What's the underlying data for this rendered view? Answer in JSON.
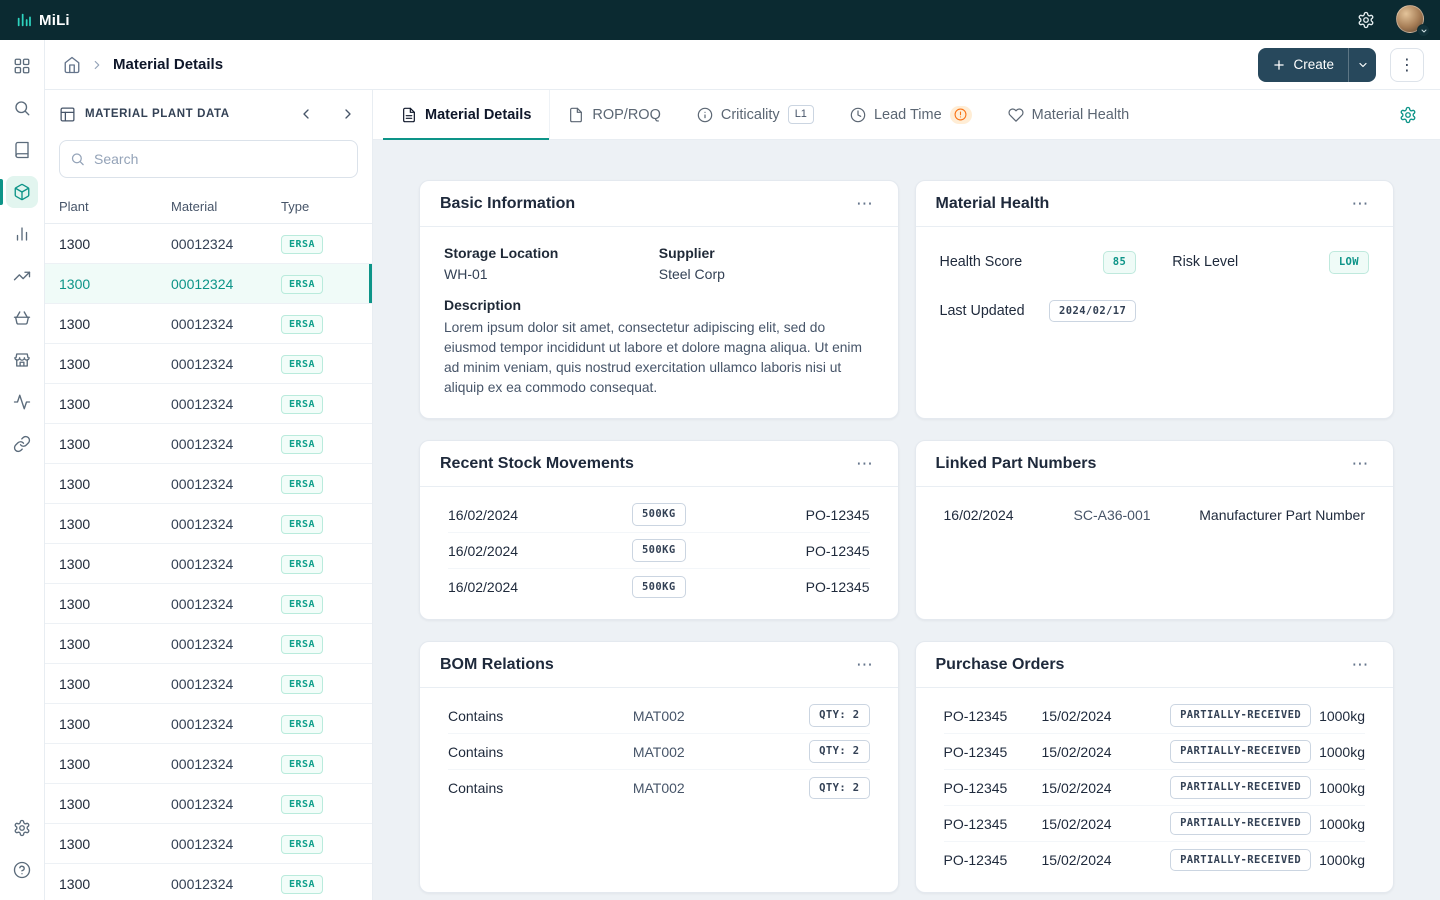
{
  "icons": {
    "kebab": "⋮",
    "ellipsis": "⋯"
  },
  "colors": {
    "accent_teal": "#0d9488",
    "topbar": "#0b2a31",
    "create_button": "#27485c",
    "warning_orange": "#f97316"
  },
  "topbar": {
    "logo": "MiLi"
  },
  "breadcrumb": {
    "page": "Material Details"
  },
  "actions": {
    "create": "Create"
  },
  "left_panel": {
    "title": "MATERIAL PLANT DATA",
    "search_placeholder": "Search",
    "columns": [
      "Plant",
      "Material",
      "Type"
    ],
    "rows": [
      {
        "plant": "1300",
        "material": "00012324",
        "type": "ERSA"
      },
      {
        "plant": "1300",
        "material": "00012324",
        "type": "ERSA",
        "selected": true
      },
      {
        "plant": "1300",
        "material": "00012324",
        "type": "ERSA"
      },
      {
        "plant": "1300",
        "material": "00012324",
        "type": "ERSA"
      },
      {
        "plant": "1300",
        "material": "00012324",
        "type": "ERSA"
      },
      {
        "plant": "1300",
        "material": "00012324",
        "type": "ERSA"
      },
      {
        "plant": "1300",
        "material": "00012324",
        "type": "ERSA"
      },
      {
        "plant": "1300",
        "material": "00012324",
        "type": "ERSA"
      },
      {
        "plant": "1300",
        "material": "00012324",
        "type": "ERSA"
      },
      {
        "plant": "1300",
        "material": "00012324",
        "type": "ERSA"
      },
      {
        "plant": "1300",
        "material": "00012324",
        "type": "ERSA"
      },
      {
        "plant": "1300",
        "material": "00012324",
        "type": "ERSA"
      },
      {
        "plant": "1300",
        "material": "00012324",
        "type": "ERSA"
      },
      {
        "plant": "1300",
        "material": "00012324",
        "type": "ERSA"
      },
      {
        "plant": "1300",
        "material": "00012324",
        "type": "ERSA"
      },
      {
        "plant": "1300",
        "material": "00012324",
        "type": "ERSA"
      },
      {
        "plant": "1300",
        "material": "00012324",
        "type": "ERSA"
      }
    ]
  },
  "tabs": [
    {
      "label": "Material Details"
    },
    {
      "label": "ROP/ROQ"
    },
    {
      "label": "Criticality",
      "badge": "L1"
    },
    {
      "label": "Lead Time"
    },
    {
      "label": "Material Health"
    }
  ],
  "cards": {
    "basic": {
      "title": "Basic Information",
      "fields": [
        {
          "label": "Storage Location",
          "value": "WH-01"
        },
        {
          "label": "Supplier",
          "value": "Steel Corp"
        }
      ],
      "description_label": "Description",
      "description": "Lorem ipsum dolor sit amet, consectetur adipiscing elit, sed do eiusmod tempor incididunt ut labore et dolore magna aliqua. Ut enim ad minim veniam, quis nostrud exercitation ullamco laboris nisi ut aliquip ex ea commodo consequat."
    },
    "health": {
      "title": "Material Health",
      "stats": [
        {
          "label": "Health Score",
          "value": "85",
          "tone": "teal"
        },
        {
          "label": "Risk Level",
          "value": "LOW",
          "tone": "teal"
        },
        {
          "label": "Last Updated",
          "value": "2024/02/17",
          "tone": "gray"
        }
      ]
    },
    "movements": {
      "title": "Recent Stock Movements",
      "rows": [
        {
          "date": "16/02/2024",
          "qty": "500KG",
          "po": "PO-12345"
        },
        {
          "date": "16/02/2024",
          "qty": "500KG",
          "po": "PO-12345"
        },
        {
          "date": "16/02/2024",
          "qty": "500KG",
          "po": "PO-12345"
        }
      ]
    },
    "linked": {
      "title": "Linked Part Numbers",
      "rows": [
        {
          "date": "16/02/2024",
          "part": "SC-A36-001",
          "desc": "Manufacturer Part Number"
        }
      ]
    },
    "bom": {
      "title": "BOM Relations",
      "rows": [
        {
          "relation": "Contains",
          "material": "MAT002",
          "qty": "QTY: 2"
        },
        {
          "relation": "Contains",
          "material": "MAT002",
          "qty": "QTY: 2"
        },
        {
          "relation": "Contains",
          "material": "MAT002",
          "qty": "QTY: 2"
        }
      ]
    },
    "purchase": {
      "title": "Purchase Orders",
      "rows": [
        {
          "po": "PO-12345",
          "date": "15/02/2024",
          "status": "PARTIALLY-RECEIVED",
          "qty": "1000kg"
        },
        {
          "po": "PO-12345",
          "date": "15/02/2024",
          "status": "PARTIALLY-RECEIVED",
          "qty": "1000kg"
        },
        {
          "po": "PO-12345",
          "date": "15/02/2024",
          "status": "PARTIALLY-RECEIVED",
          "qty": "1000kg"
        },
        {
          "po": "PO-12345",
          "date": "15/02/2024",
          "status": "PARTIALLY-RECEIVED",
          "qty": "1000kg"
        },
        {
          "po": "PO-12345",
          "date": "15/02/2024",
          "status": "PARTIALLY-RECEIVED",
          "qty": "1000kg"
        }
      ]
    }
  }
}
